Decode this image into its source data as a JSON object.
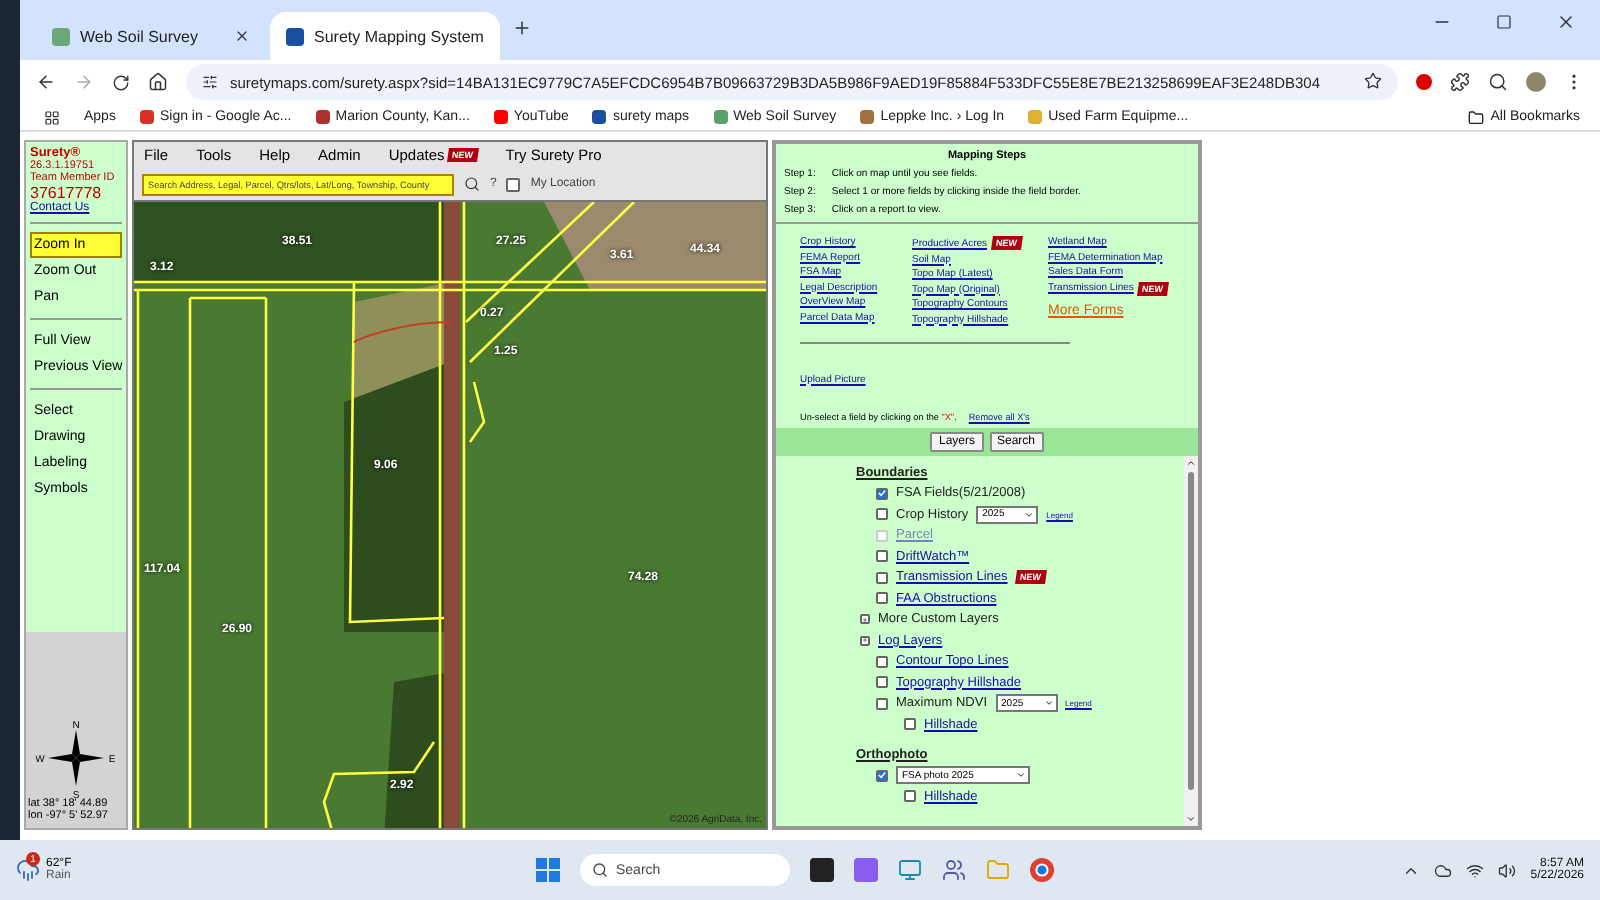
{
  "browser": {
    "tabs": [
      {
        "title": "Web Soil Survey",
        "selected": false
      },
      {
        "title": "Surety Mapping System",
        "selected": true
      }
    ],
    "url": "suretymaps.com/surety.aspx?sid=14BA131EC9779C7A5EFCDC6954B7B09663729B3DA5B986F9AED19F85884F533DFC55E8E7BE213258699EAF3E248DB304",
    "bookmarks": [
      "Apps",
      "Sign in - Google Ac...",
      "Marion County, Kan...",
      "YouTube",
      "surety maps",
      "Web Soil Survey",
      "Leppke Inc. › Log In",
      "Used Farm Equipme..."
    ],
    "all_bookmarks": "All Bookmarks"
  },
  "sidebar": {
    "brand": "Surety®",
    "version": "26.3.1.19751",
    "member_label": "Team Member ID",
    "member_id": "37617778",
    "contact": "Contact Us",
    "groups": [
      [
        {
          "label": "Zoom In",
          "selected": true
        },
        {
          "label": "Zoom Out",
          "selected": false
        },
        {
          "label": "Pan",
          "selected": false
        }
      ],
      [
        {
          "label": "Full View",
          "selected": false
        },
        {
          "label": "Previous View",
          "selected": false
        }
      ],
      [
        {
          "label": "Select",
          "selected": false
        },
        {
          "label": "Drawing",
          "selected": false
        },
        {
          "label": "Labeling",
          "selected": false
        },
        {
          "label": "Symbols",
          "selected": false
        }
      ]
    ],
    "compass": {
      "n": "N",
      "s": "S",
      "e": "E",
      "w": "W"
    },
    "lat": "lat 38° 18' 44.89",
    "lon": "lon -97° 5' 52.97"
  },
  "map": {
    "menu": [
      {
        "label": "File"
      },
      {
        "label": "Tools"
      },
      {
        "label": "Help"
      },
      {
        "label": "Admin"
      },
      {
        "label": "Updates",
        "badge": "NEW"
      },
      {
        "label": "Try Surety Pro"
      }
    ],
    "search_placeholder": "Search Address, Legal, Parcel, Qtrs/lots, Lat/Long, Township, County",
    "help": "?",
    "my_location": {
      "label": "My Location",
      "checked": false
    },
    "acreages": [
      "38.51",
      "27.25",
      "3.61",
      "44.34",
      "3.12",
      "0.27",
      "1.25",
      "9.06",
      "117.04",
      "26.90",
      "74.28",
      "2.92"
    ],
    "copyright": "©2026 AgriData, Inc."
  },
  "panel": {
    "steps": {
      "title": "Mapping Steps",
      "items": [
        {
          "step": "Step 1:",
          "text": "Click on map until you see fields."
        },
        {
          "step": "Step 2:",
          "text": "Select 1 or more fields by clicking inside the field border."
        },
        {
          "step": "Step 3:",
          "text": "Click on a report to view."
        }
      ]
    },
    "reports": [
      [
        {
          "label": "Crop History"
        },
        {
          "label": "FEMA Report"
        },
        {
          "label": "FSA Map"
        },
        {
          "label": "Legal Description"
        },
        {
          "label": "OverView Map"
        },
        {
          "label": "Parcel Data Map"
        }
      ],
      [
        {
          "label": "Productive Acres",
          "badge": "NEW"
        },
        {
          "label": "Soil Map"
        },
        {
          "label": "Topo Map (Latest)"
        },
        {
          "label": "Topo Map (Original)"
        },
        {
          "label": "Topography Contours"
        },
        {
          "label": "Topography Hillshade"
        }
      ],
      [
        {
          "label": "Wetland Map"
        },
        {
          "label": "FEMA Determination Map"
        },
        {
          "label": "Sales Data Form"
        },
        {
          "label": "Transmission Lines",
          "badge": "NEW"
        }
      ]
    ],
    "more_forms": "More Forms",
    "upload": "Upload Picture",
    "unselect": {
      "before": "Un-select a field by clicking on the ",
      "mark": "\"X\"",
      "after": ".",
      "link": "Remove all X's"
    },
    "buttons": [
      "Layers",
      "Search"
    ],
    "layers": [
      {
        "title": "Boundaries",
        "items": [
          {
            "kind": "check",
            "label": "FSA Fields(5/21/2008)",
            "checked": true,
            "disabled": false,
            "link": false
          },
          {
            "kind": "select",
            "label": "Crop History",
            "checked": false,
            "disabled": false,
            "link": false,
            "value": "2025",
            "legend": "Legend"
          },
          {
            "kind": "check",
            "label": "Parcel",
            "checked": false,
            "disabled": true,
            "link": true
          },
          {
            "kind": "check",
            "label": "DriftWatch™",
            "checked": false,
            "disabled": false,
            "link": true
          },
          {
            "kind": "check",
            "label": "Transmission Lines",
            "checked": false,
            "disabled": false,
            "link": true,
            "badge": "NEW"
          },
          {
            "kind": "check",
            "label": "FAA Obstructions",
            "checked": false,
            "disabled": false,
            "link": true
          },
          {
            "kind": "expander",
            "label": "More Custom Layers",
            "link": false
          },
          {
            "kind": "expander",
            "label": "Log Layers",
            "link": true
          },
          {
            "kind": "check",
            "label": "Contour Topo Lines",
            "checked": false,
            "disabled": false,
            "link": true
          },
          {
            "kind": "check",
            "label": "Topography Hillshade",
            "checked": false,
            "disabled": false,
            "link": true
          },
          {
            "kind": "select",
            "label": "Maximum NDVI",
            "checked": false,
            "disabled": false,
            "link": false,
            "value": "2025",
            "legend": "Legend",
            "children": [
              {
                "kind": "check",
                "label": "Hillshade",
                "checked": false,
                "disabled": false,
                "link": true
              }
            ]
          }
        ]
      },
      {
        "title": "Orthophoto",
        "items": [
          {
            "kind": "photo",
            "checked": true,
            "disabled": false,
            "value": "FSA photo 2025",
            "children": [
              {
                "kind": "check",
                "label": "Hillshade",
                "checked": false,
                "disabled": false,
                "link": true
              }
            ]
          }
        ]
      }
    ]
  },
  "taskbar": {
    "weather": {
      "temp": "62°F",
      "condition": "Rain",
      "alerts": "1"
    },
    "search_placeholder": "Search",
    "time": "8:57 AM",
    "date": "5/22/2026"
  }
}
